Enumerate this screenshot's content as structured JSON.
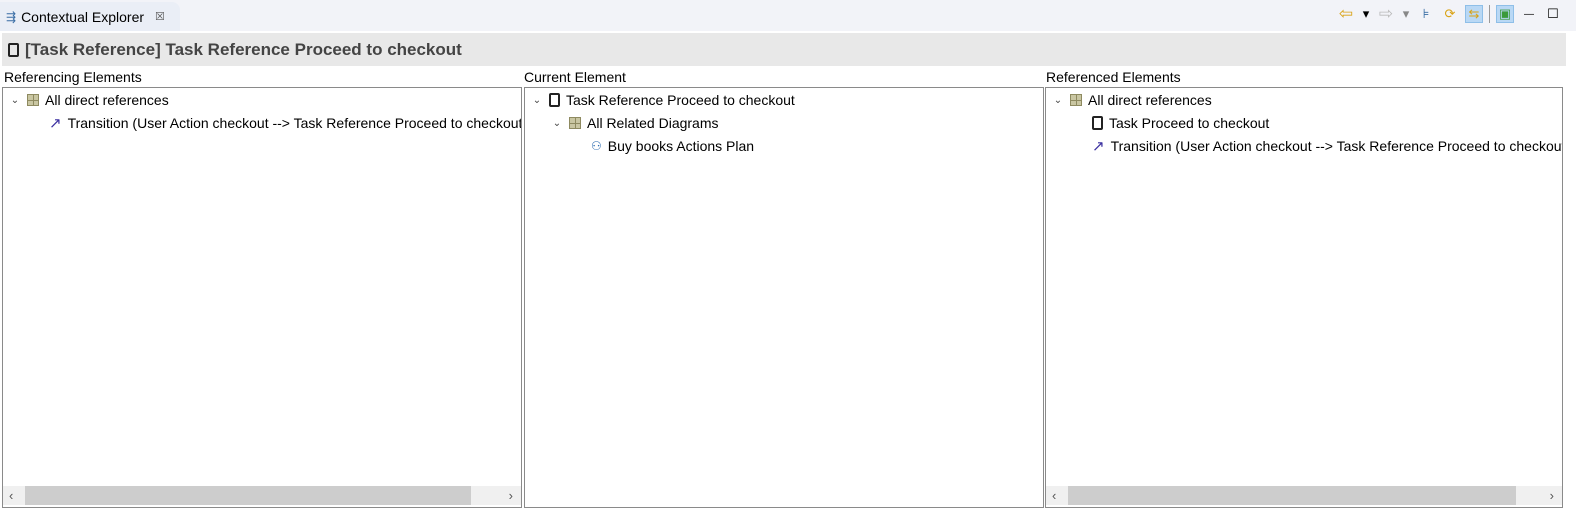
{
  "tab": {
    "title": "Contextual Explorer",
    "close": "☒"
  },
  "toolbar": {
    "back": "⇦",
    "back_menu": "▾",
    "forward": "⇨",
    "forward_menu": "▾",
    "hierarchy": "⊧",
    "sync": "⟳",
    "link": "⇆",
    "diagram": "▣",
    "minimize": "—",
    "maximize": "☐"
  },
  "header": {
    "title": "[Task Reference] Task Reference Proceed to checkout"
  },
  "panels": {
    "referencing": {
      "label": "Referencing Elements",
      "root": "All direct references",
      "child": "Transition (User Action checkout --> Task Reference Proceed to checkout)"
    },
    "current": {
      "label": "Current Element",
      "root": "Task Reference Proceed to checkout",
      "group": "All Related Diagrams",
      "child": "Buy books Actions Plan"
    },
    "referenced": {
      "label": "Referenced Elements",
      "root": "All direct references",
      "child1": "Task Proceed to checkout",
      "child2": "Transition (User Action checkout --> Task Reference Proceed to checkout)"
    }
  },
  "scroll": {
    "left": "‹",
    "right": "›"
  }
}
